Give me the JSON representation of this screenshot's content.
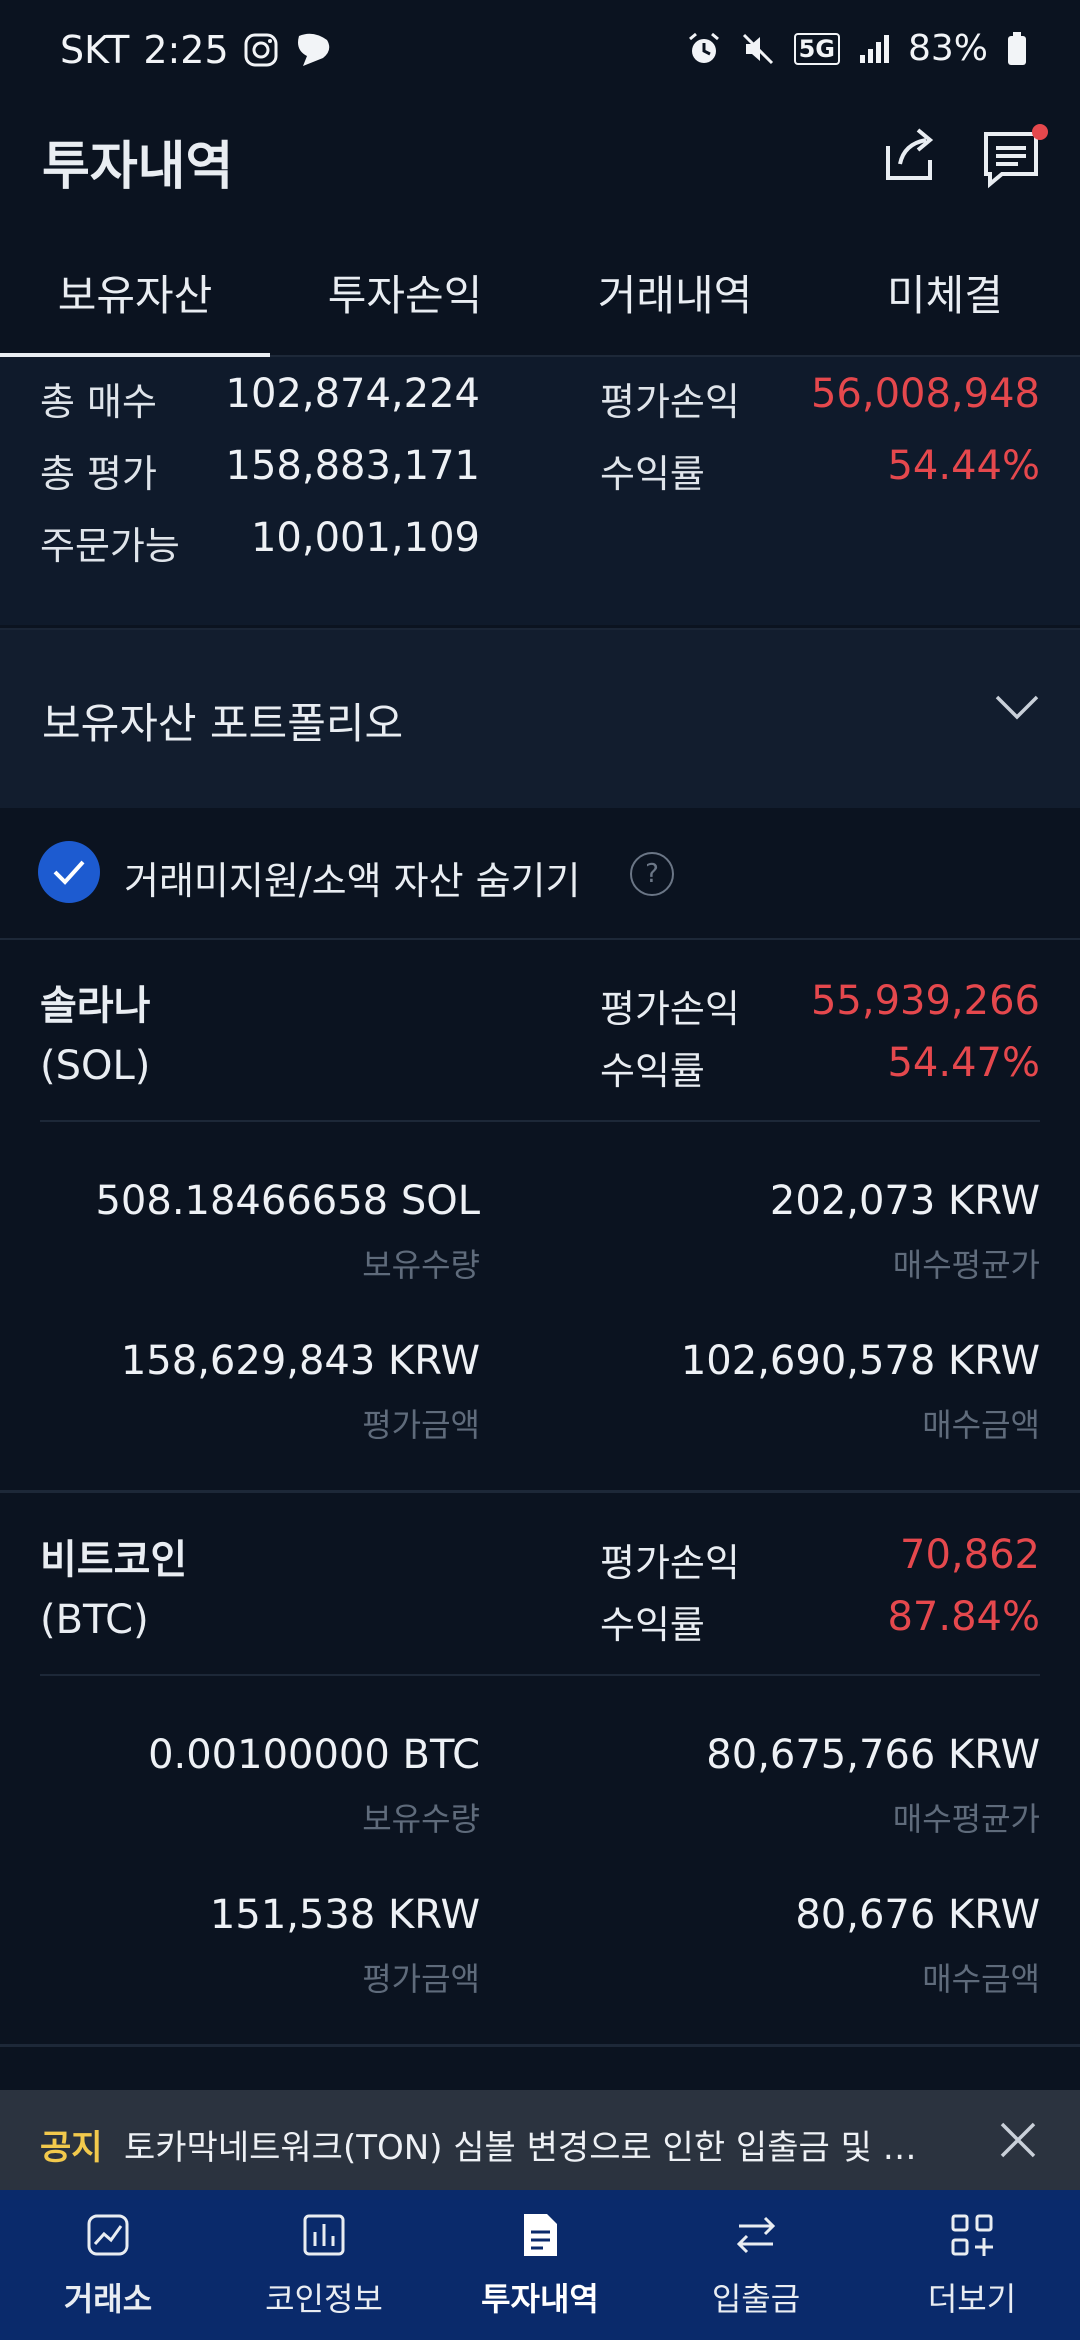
{
  "status_bar": {
    "carrier": "SKT",
    "time": "2:25",
    "network": "5G",
    "battery": "83%"
  },
  "header": {
    "title": "투자내역"
  },
  "tabs": [
    {
      "label": "보유자산",
      "active": true
    },
    {
      "label": "투자손익",
      "active": false
    },
    {
      "label": "거래내역",
      "active": false
    },
    {
      "label": "미체결",
      "active": false
    }
  ],
  "summary": {
    "total_buy_label": "총 매수",
    "total_buy": "102,874,224",
    "total_eval_label": "총 평가",
    "total_eval": "158,883,171",
    "orderable_label": "주문가능",
    "orderable": "10,001,109",
    "pnl_label": "평가손익",
    "pnl": "56,008,948",
    "return_label": "수익률",
    "return_rate": "54.44%"
  },
  "portfolio": {
    "title": "보유자산 포트폴리오"
  },
  "hide_toggle": {
    "label": "거래미지원/소액 자산 숨기기",
    "checked": true
  },
  "assets": [
    {
      "name": "솔라나",
      "symbol": "(SOL)",
      "pnl_label": "평가손익",
      "pnl": "55,939,266",
      "return_label": "수익률",
      "return_rate": "54.47%",
      "quantity": "508.18466658 SOL",
      "quantity_label": "보유수량",
      "avg_price": "202,073  KRW",
      "avg_price_label": "매수평균가",
      "eval_amount": "158,629,843  KRW",
      "eval_amount_label": "평가금액",
      "buy_amount": "102,690,578  KRW",
      "buy_amount_label": "매수금액"
    },
    {
      "name": "비트코인",
      "symbol": "(BTC)",
      "pnl_label": "평가손익",
      "pnl": "70,862",
      "return_label": "수익률",
      "return_rate": "87.84%",
      "quantity": "0.00100000 BTC",
      "quantity_label": "보유수량",
      "avg_price": "80,675,766  KRW",
      "avg_price_label": "매수평균가",
      "eval_amount": "151,538  KRW",
      "eval_amount_label": "평가금액",
      "buy_amount": "80,676  KRW",
      "buy_amount_label": "매수금액"
    }
  ],
  "notice": {
    "tag": "공지",
    "text": "토카막네트워크(TON) 심볼 변경으로 인한 입출금 및 거래..."
  },
  "bottom_nav": [
    {
      "label": "거래소",
      "icon": "exchange-chart-icon",
      "active": false
    },
    {
      "label": "코인정보",
      "icon": "bar-chart-icon",
      "active": false
    },
    {
      "label": "투자내역",
      "icon": "document-icon",
      "active": true
    },
    {
      "label": "입출금",
      "icon": "transfer-arrows-icon",
      "active": false
    },
    {
      "label": "더보기",
      "icon": "grid-plus-icon",
      "active": false
    }
  ],
  "colors": {
    "background": "#0b1320",
    "profit_red": "#e5484d",
    "nav_background": "#0a2a6b",
    "accent_blue": "#1d5bd0",
    "notice_tag": "#f2c94c"
  }
}
